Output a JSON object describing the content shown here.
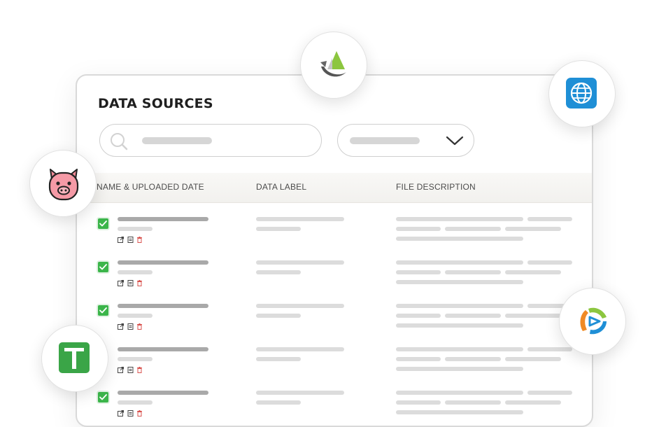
{
  "title": "DATA SOURCES",
  "columns": {
    "name": "NAME & UPLOADED DATE",
    "label": "DATA LABEL",
    "description": "FILE DESCRIPTION"
  },
  "rows": [
    {
      "checked": true
    },
    {
      "checked": true
    },
    {
      "checked": true
    },
    {
      "checked": false
    },
    {
      "checked": true
    }
  ],
  "colors": {
    "checkbox": "#3bb54a",
    "heading": "#1f1f1f",
    "skeleton": "#dcdcdc",
    "skeleton_dark": "#a9a9a9",
    "delete_icon": "#d9534f"
  },
  "integrations": [
    {
      "icon": "sail-logo-icon"
    },
    {
      "icon": "globe-icon"
    },
    {
      "icon": "pig-icon"
    },
    {
      "icon": "green-cross-icon"
    },
    {
      "icon": "swirl-logo-icon"
    }
  ]
}
